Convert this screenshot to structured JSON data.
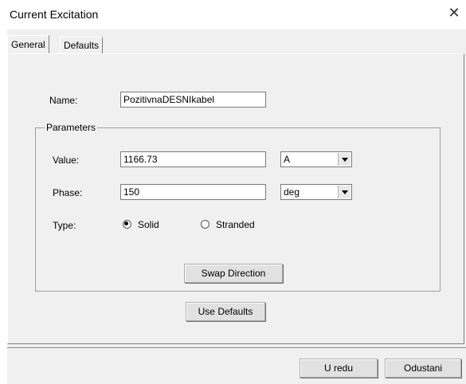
{
  "window": {
    "title": "Current Excitation"
  },
  "tabs": [
    {
      "label": "General"
    },
    {
      "label": "Defaults"
    }
  ],
  "general": {
    "name_label": "Name:",
    "name_value": "PozitivnaDESNIkabel",
    "parameters_legend": "Parameters",
    "value_label": "Value:",
    "value_value": "1166.73",
    "value_unit": "A",
    "phase_label": "Phase:",
    "phase_value": "150",
    "phase_unit": "deg",
    "type_label": "Type:",
    "type_options": [
      {
        "label": "Solid",
        "selected": true
      },
      {
        "label": "Stranded",
        "selected": false
      }
    ],
    "swap_label": "Swap Direction",
    "use_defaults_label": "Use Defaults"
  },
  "footer": {
    "ok_label": "U redu",
    "cancel_label": "Odustani"
  },
  "icons": {
    "close": "close-icon",
    "dropdown": "chevron-down-icon",
    "radio": "radio-icon"
  }
}
